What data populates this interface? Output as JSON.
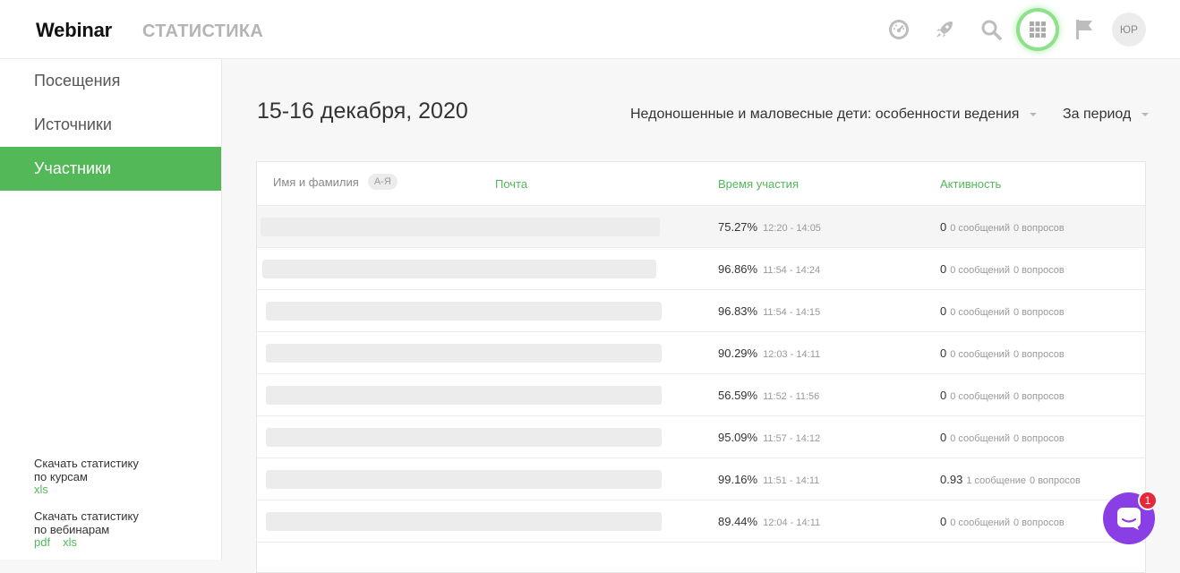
{
  "header": {
    "logo": "Webinar",
    "section": "СТАТИСТИКА",
    "icons": [
      "dashboard-icon",
      "rocket-icon",
      "search-icon",
      "apps-grid-icon",
      "flag-icon"
    ],
    "avatar": "ЮР"
  },
  "sidebar": {
    "items": [
      {
        "label": "Посещения"
      },
      {
        "label": "Источники"
      },
      {
        "label": "Участники",
        "active": true
      }
    ],
    "download_courses": {
      "line1": "Скачать статистику",
      "line2": "по курсам",
      "xls": "xls"
    },
    "download_webinars": {
      "line1": "Скачать статистику",
      "line2": "по вебинарам",
      "pdf": "pdf",
      "xls": "xls"
    }
  },
  "main": {
    "date": "15-16 декабря, 2020",
    "event_select": "Недоношенные и маловесные дети: особенности ведения",
    "period_select": "За период",
    "table": {
      "headers": {
        "name": "Имя и фамилия",
        "sort": "А-Я",
        "email": "Почта",
        "time": "Время участия",
        "activity": "Активность"
      },
      "rows": [
        {
          "percent": "75.27%",
          "time": "12:20 - 14:05",
          "score": "0",
          "messages": "0 сообщений",
          "questions": "0 вопросов"
        },
        {
          "percent": "96.86%",
          "time": "11:54 - 14:24",
          "score": "0",
          "messages": "0 сообщений",
          "questions": "0 вопросов"
        },
        {
          "percent": "96.83%",
          "time": "11:54 - 14:15",
          "score": "0",
          "messages": "0 сообщений",
          "questions": "0 вопросов"
        },
        {
          "percent": "90.29%",
          "time": "12:03 - 14:11",
          "score": "0",
          "messages": "0 сообщений",
          "questions": "0 вопросов"
        },
        {
          "percent": "56.59%",
          "time": "11:52 - 11:56",
          "score": "0",
          "messages": "0 сообщений",
          "questions": "0 вопросов"
        },
        {
          "percent": "95.09%",
          "time": "11:57 - 14:12",
          "score": "0",
          "messages": "0 сообщений",
          "questions": "0 вопросов"
        },
        {
          "percent": "99.16%",
          "time": "11:51 - 14:11",
          "score": "0.93",
          "messages": "1 сообщение",
          "questions": "0 вопросов"
        },
        {
          "percent": "89.44%",
          "time": "12:04 - 14:11",
          "score": "0",
          "messages": "0 сообщений",
          "questions": "0 вопросов"
        }
      ]
    }
  },
  "chat": {
    "badge": "1"
  },
  "colors": {
    "accent": "#53b858",
    "chat": "#8a3ee6",
    "badge": "#e5283c"
  }
}
